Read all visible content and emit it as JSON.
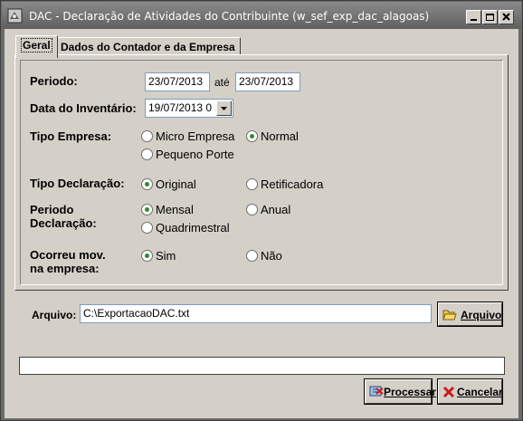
{
  "window": {
    "title": "DAC - Declaração de Atividades do Contribuinte (w_sef_exp_dac_alagoas)"
  },
  "tabs": [
    {
      "label": "Geral",
      "active": true
    },
    {
      "label": "Dados do Contador e da Empresa",
      "active": false
    }
  ],
  "form": {
    "periodo": {
      "label": "Periodo:",
      "start": "23/07/2013",
      "separator": "até",
      "end": "23/07/2013"
    },
    "inventario": {
      "label": "Data do Inventário:",
      "value": "19/07/2013 0"
    },
    "tipo_empresa": {
      "label": "Tipo Empresa:",
      "options": [
        "Micro Empresa",
        "Normal",
        "Pequeno Porte"
      ],
      "selected": "Normal"
    },
    "tipo_declaracao": {
      "label": "Tipo Declaração:",
      "options": [
        "Original",
        "Retificadora"
      ],
      "selected": "Original"
    },
    "periodo_declaracao": {
      "label_line1": "Periodo",
      "label_line2": "Declaração:",
      "options": [
        "Mensal",
        "Anual",
        "Quadrimestral"
      ],
      "selected": "Mensal"
    },
    "ocorreu_mov": {
      "label_line1": "Ocorreu mov.",
      "label_line2": "na empresa:",
      "options": [
        "Sim",
        "Não"
      ],
      "selected": "Sim"
    }
  },
  "arquivo": {
    "label": "Arquivo:",
    "value": "C:\\ExportacaoDAC.txt",
    "button_label": "Arquivo",
    "button_icon": "open-folder-icon"
  },
  "progress": {
    "value": 0
  },
  "buttons": {
    "processar": {
      "label": "Processar",
      "icon": "process-icon"
    },
    "cancelar": {
      "label": "Cancelar",
      "icon": "cancel-x-icon"
    }
  },
  "colors": {
    "radio_selected": "#2e8b2e",
    "window_face": "#d4d0c8",
    "titlebar": "#6b6b6b",
    "cancel_x": "#cc1a1a"
  }
}
